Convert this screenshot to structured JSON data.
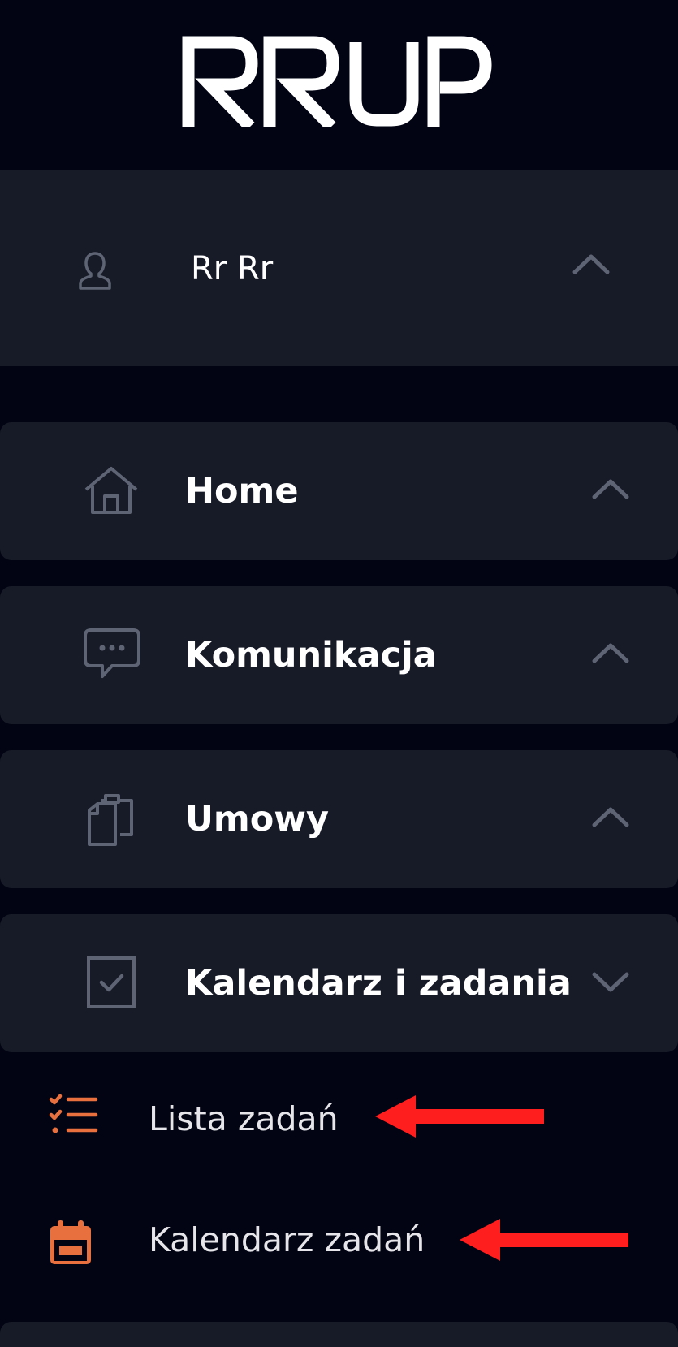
{
  "app": {
    "logo_text": "RRUP"
  },
  "user": {
    "name": "Rr Rr",
    "icon": "user-icon"
  },
  "menu": [
    {
      "label": "Home",
      "icon": "home-icon",
      "expanded": false
    },
    {
      "label": "Komunikacja",
      "icon": "chat-bubble-icon",
      "expanded": false
    },
    {
      "label": "Umowy",
      "icon": "clipboard-documents-icon",
      "expanded": false
    },
    {
      "label": "Kalendarz i zadania",
      "icon": "checkbox-icon",
      "expanded": true
    }
  ],
  "submenu": [
    {
      "label": "Lista zadań",
      "icon": "checklist-icon"
    },
    {
      "label": "Kalendarz zadań",
      "icon": "calendar-icon"
    }
  ],
  "colors": {
    "background": "#020414",
    "panel": "#171a27",
    "icon_muted": "#5f6474",
    "accent_orange": "#e8703f",
    "annotation_arrow": "#ff1e1e"
  }
}
